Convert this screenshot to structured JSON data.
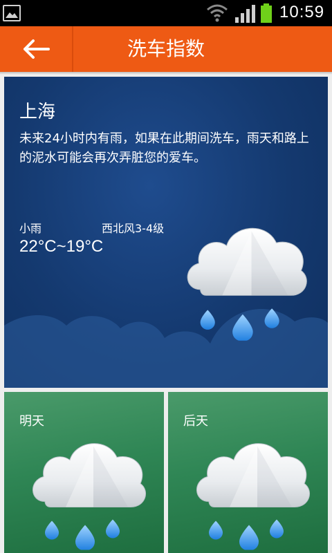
{
  "status_bar": {
    "time": "10:59",
    "icons": [
      "gallery-icon",
      "wifi-icon",
      "signal-icon",
      "battery-icon"
    ]
  },
  "title_bar": {
    "back_icon": "arrow-left-icon",
    "title": "洗车指数",
    "color": "#ee5a14"
  },
  "today": {
    "city": "上海",
    "description": "未来24小时内有雨，如果在此期间洗车，雨天和路上的泥水可能会再次弄脏您的爱车。",
    "condition": "小雨",
    "wind": "西北风3-4级",
    "temperature": "22°C~19°C",
    "weather_icon": "rain-cloud-icon",
    "background": "#14396f"
  },
  "forecast": [
    {
      "label": "明天",
      "weather_icon": "rain-cloud-icon",
      "background": "#2f8655"
    },
    {
      "label": "后天",
      "weather_icon": "rain-cloud-icon",
      "background": "#2f8655"
    }
  ]
}
